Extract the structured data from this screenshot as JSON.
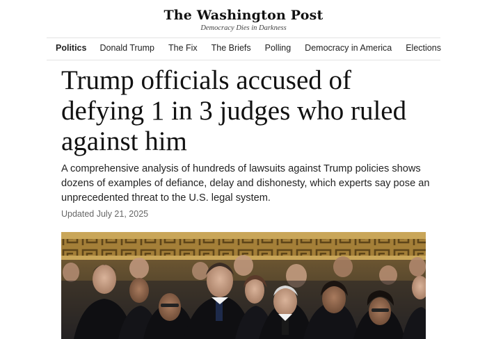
{
  "masthead": {
    "logo": "The Washington Post",
    "tagline": "Democracy Dies in Darkness"
  },
  "nav": {
    "items": [
      {
        "label": "Politics",
        "active": true
      },
      {
        "label": "Donald Trump"
      },
      {
        "label": "The Fix"
      },
      {
        "label": "The Briefs"
      },
      {
        "label": "Polling"
      },
      {
        "label": "Democracy in America"
      },
      {
        "label": "Elections"
      }
    ]
  },
  "article": {
    "headline": "Trump officials accused of defying 1 in 3 judges who ruled against him",
    "deck": "A comprehensive analysis of hundreds of lawsuits against Trump policies shows dozens of examples of defiance, delay and dishonesty, which experts say pose an unprecedented threat to the U.S. legal system.",
    "timestamp": "Updated July 21, 2025"
  },
  "colors": {
    "text": "#111111",
    "muted": "#666666",
    "rule": "#e3e3e3",
    "frieze_gold": "#b08a3e",
    "robe": "#0f0f12"
  }
}
